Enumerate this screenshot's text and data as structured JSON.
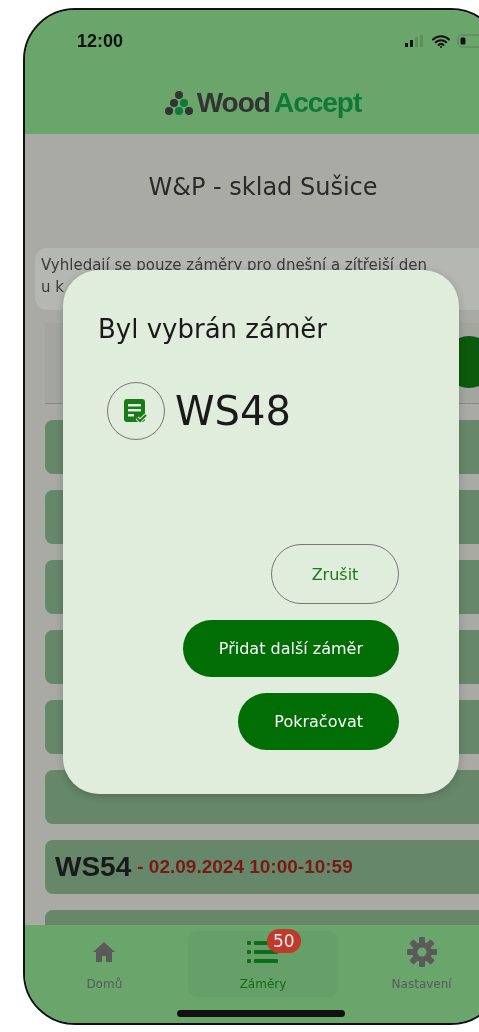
{
  "status_bar": {
    "time": "12:00"
  },
  "header": {
    "logo": {
      "first": "Wood",
      "second": "Accept"
    }
  },
  "page": {
    "title": "W&P - sklad Sušice",
    "info": "Vyhledají se pouze záměry pro dnešní a zítřejší den\nu k"
  },
  "list": [
    {
      "code": "WS54",
      "date": "- 02.09.2024 10:00-10:59"
    }
  ],
  "dialog": {
    "title": "Byl vybrán záměr",
    "selected_code": "WS48",
    "buttons": [
      {
        "label": "Zrušit",
        "kind": "outlined"
      },
      {
        "label": "Přidat další záměr",
        "kind": "filled"
      },
      {
        "label": "Pokračovat",
        "kind": "filled"
      }
    ]
  },
  "tab_bar": [
    {
      "label": "Domů",
      "selected": false
    },
    {
      "label": "Záměry",
      "selected": true,
      "badge": "50"
    },
    {
      "label": "Nastavení",
      "selected": false
    }
  ]
}
